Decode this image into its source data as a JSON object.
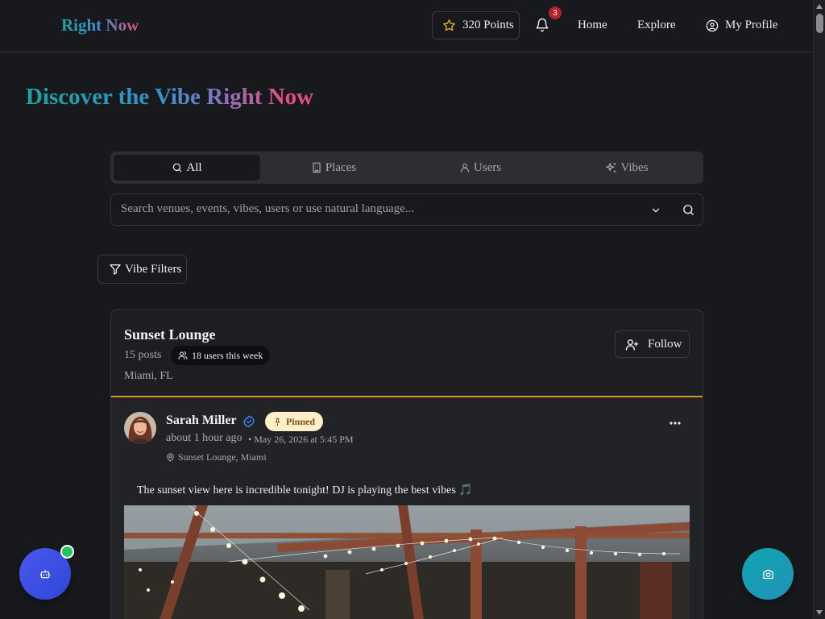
{
  "header": {
    "logo": "Right Now",
    "points_label": "320 Points",
    "notification_count": "3",
    "nav": {
      "home": "Home",
      "explore": "Explore",
      "profile": "My Profile"
    }
  },
  "hero": {
    "title": "Discover the Vibe Right Now"
  },
  "tabs": [
    {
      "label": "All",
      "icon": "search-icon",
      "active": true
    },
    {
      "label": "Places",
      "icon": "building-icon",
      "active": false
    },
    {
      "label": "Users",
      "icon": "user-icon",
      "active": false
    },
    {
      "label": "Vibes",
      "icon": "sparkles-icon",
      "active": false
    }
  ],
  "search": {
    "placeholder": "Search venues, events, vibes, users or use natural language...",
    "value": ""
  },
  "filters": {
    "label": "Vibe Filters"
  },
  "venue": {
    "name": "Sunset Lounge",
    "posts": "15 posts",
    "users_week": "18 users this week",
    "location": "Miami, FL",
    "follow_label": "Follow"
  },
  "post": {
    "author": "Sarah Miller",
    "pinned_label": "Pinned",
    "time_ago": "about 1 hour ago",
    "time_exact": "• May 26, 2026 at 5:45 PM",
    "location": "Sunset Lounge, Miami",
    "text": "The sunset view here is incredible tonight! DJ is playing the best vibes 🎵"
  },
  "colors": {
    "background": "#18191c",
    "accent_bar": "#d99524",
    "pinned_bg": "#fdf0c8",
    "badge": "#b5202b",
    "fab_left": "#4b58ee",
    "fab_right": "#0ea5b0",
    "online_dot": "#22c55e"
  }
}
